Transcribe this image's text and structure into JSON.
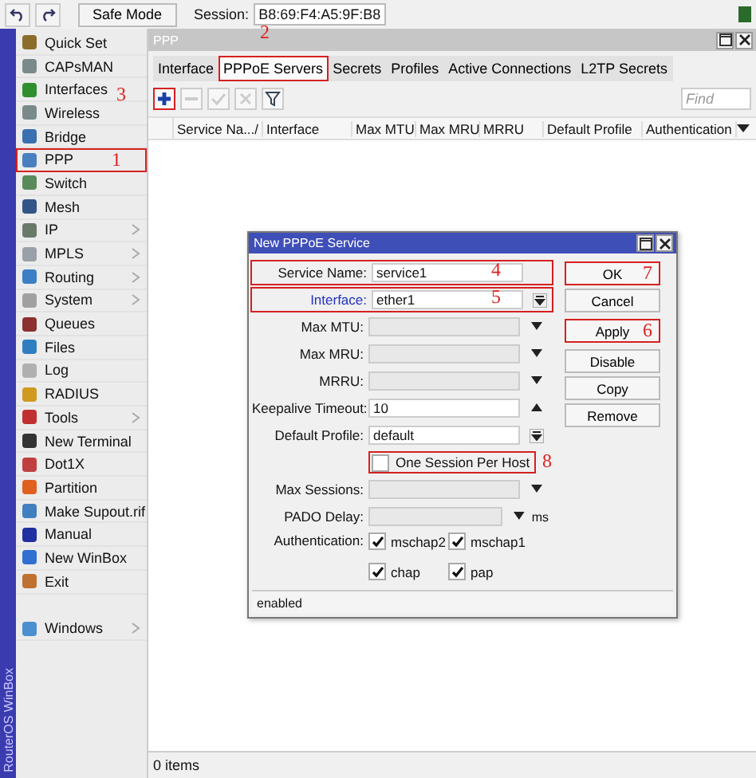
{
  "toolbar": {
    "safe_mode": "Safe Mode",
    "session_label": "Session:",
    "session_value": "B8:69:F4:A5:9F:B8"
  },
  "side_label": "RouterOS WinBox",
  "sidebar": {
    "items": [
      {
        "label": "Quick Set",
        "submenu": false
      },
      {
        "label": "CAPsMAN",
        "submenu": false
      },
      {
        "label": "Interfaces",
        "submenu": false
      },
      {
        "label": "Wireless",
        "submenu": false
      },
      {
        "label": "Bridge",
        "submenu": false
      },
      {
        "label": "PPP",
        "submenu": false,
        "annotation": "1"
      },
      {
        "label": "Switch",
        "submenu": false
      },
      {
        "label": "Mesh",
        "submenu": false
      },
      {
        "label": "IP",
        "submenu": true
      },
      {
        "label": "MPLS",
        "submenu": true
      },
      {
        "label": "Routing",
        "submenu": true
      },
      {
        "label": "System",
        "submenu": true
      },
      {
        "label": "Queues",
        "submenu": false
      },
      {
        "label": "Files",
        "submenu": false
      },
      {
        "label": "Log",
        "submenu": false
      },
      {
        "label": "RADIUS",
        "submenu": false
      },
      {
        "label": "Tools",
        "submenu": true
      },
      {
        "label": "New Terminal",
        "submenu": false
      },
      {
        "label": "Dot1X",
        "submenu": false
      },
      {
        "label": "Partition",
        "submenu": false
      },
      {
        "label": "Make Supout.rif",
        "submenu": false
      },
      {
        "label": "Manual",
        "submenu": false
      },
      {
        "label": "New WinBox",
        "submenu": false
      },
      {
        "label": "Exit",
        "submenu": false
      },
      {
        "label": "Windows",
        "submenu": true,
        "gap_before": true
      }
    ]
  },
  "ppp_window": {
    "title": "PPP",
    "tabs": [
      {
        "label": "Interface",
        "selected": false
      },
      {
        "label": "PPPoE Servers",
        "selected": true,
        "annotation": "2"
      },
      {
        "label": "Secrets",
        "selected": false
      },
      {
        "label": "Profiles",
        "selected": false
      },
      {
        "label": "Active Connections",
        "selected": false
      },
      {
        "label": "L2TP Secrets",
        "selected": false
      }
    ],
    "add_annotation": "3",
    "find": {
      "placeholder": "Find"
    },
    "columns": [
      "Service Na.../",
      "Interface",
      "Max MTU",
      "Max MRU",
      "MRRU",
      "Default Profile",
      "Authentication"
    ],
    "status": "0 items"
  },
  "dialog": {
    "title": "New PPPoE Service",
    "fields": [
      {
        "kind": "text",
        "label": "Service Name:",
        "value": "service1",
        "annotation": "4"
      },
      {
        "kind": "select",
        "label": "Interface:",
        "value": "ether1",
        "annotation": "5",
        "link": true
      },
      {
        "kind": "down",
        "label": "Max MTU:"
      },
      {
        "kind": "down",
        "label": "Max MRU:"
      },
      {
        "kind": "down",
        "label": "MRRU:"
      },
      {
        "kind": "up",
        "label": "Keepalive Timeout:",
        "value": "10"
      },
      {
        "kind": "select",
        "label": "Default Profile:",
        "value": "default"
      },
      {
        "kind": "checkbox",
        "label": "One Session Per Host",
        "checked": false,
        "annotation": "8"
      },
      {
        "kind": "down",
        "label": "Max Sessions:"
      },
      {
        "kind": "down",
        "label": "PADO Delay:",
        "unit": "ms"
      },
      {
        "kind": "checks",
        "label": "Authentication:",
        "options": [
          {
            "label": "mschap2",
            "checked": true
          },
          {
            "label": "mschap1",
            "checked": true
          },
          {
            "label": "chap",
            "checked": true
          },
          {
            "label": "pap",
            "checked": true
          }
        ]
      }
    ],
    "buttons": [
      {
        "label": "OK",
        "annotation": "7"
      },
      {
        "label": "Cancel"
      },
      {
        "label": "Apply",
        "annotation": "6"
      },
      {
        "label": "Disable"
      },
      {
        "label": "Copy"
      },
      {
        "label": "Remove"
      }
    ],
    "status": "enabled"
  }
}
